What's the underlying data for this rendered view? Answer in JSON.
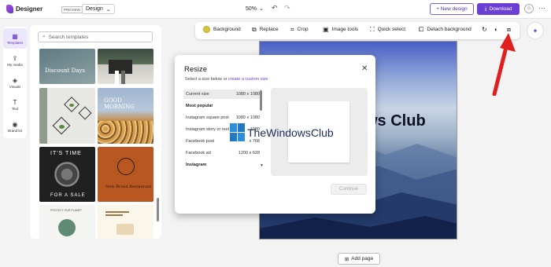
{
  "topbar": {
    "app_name": "Designer",
    "badge": "PREVIEW",
    "design_label": "Design",
    "zoom": "50%",
    "new_design": "+ New design",
    "download": "Download"
  },
  "nav": {
    "items": [
      {
        "label": "Templates",
        "icon": "template-icon"
      },
      {
        "label": "My media",
        "icon": "upload-icon"
      },
      {
        "label": "Visuals",
        "icon": "visuals-icon"
      },
      {
        "label": "Text",
        "icon": "text-icon"
      },
      {
        "label": "Brand kit",
        "icon": "brand-icon"
      }
    ]
  },
  "templates": {
    "search_placeholder": "Search templates",
    "t1": "Discount Days",
    "t3": "GOOD MORNING",
    "t5a": "IT'S TIME",
    "t5b": "FOR A SALE",
    "t6": "New Brand Restaurant",
    "t7": "PROTECT OUR PLANET"
  },
  "toolbar": {
    "background": "Background",
    "replace": "Replace",
    "crop": "Crop",
    "image_tools": "Image tools",
    "quick_select": "Quick select",
    "detach_background": "Detach background",
    "swatch_color": "#d8c43a"
  },
  "canvas": {
    "title": "ws Club",
    "add_page": "Add page"
  },
  "dialog": {
    "title": "Resize",
    "subtitle_prefix": "Select a size below or",
    "subtitle_link": "create a custom size",
    "rows": [
      {
        "name": "Current size",
        "size": "1080 x 1080"
      },
      {
        "name": "Most popular",
        "size": ""
      },
      {
        "name": "Instagram square post",
        "size": "1080 x 1080"
      },
      {
        "name": "Instagram story or reel",
        "size": "1080"
      },
      {
        "name": "Facebook post",
        "size": "x 768"
      },
      {
        "name": "Facebook ad",
        "size": "1200 x 628"
      },
      {
        "name": "Instagram",
        "size": ""
      }
    ],
    "continue": "Continue"
  },
  "watermark": "TheWindowsClub"
}
